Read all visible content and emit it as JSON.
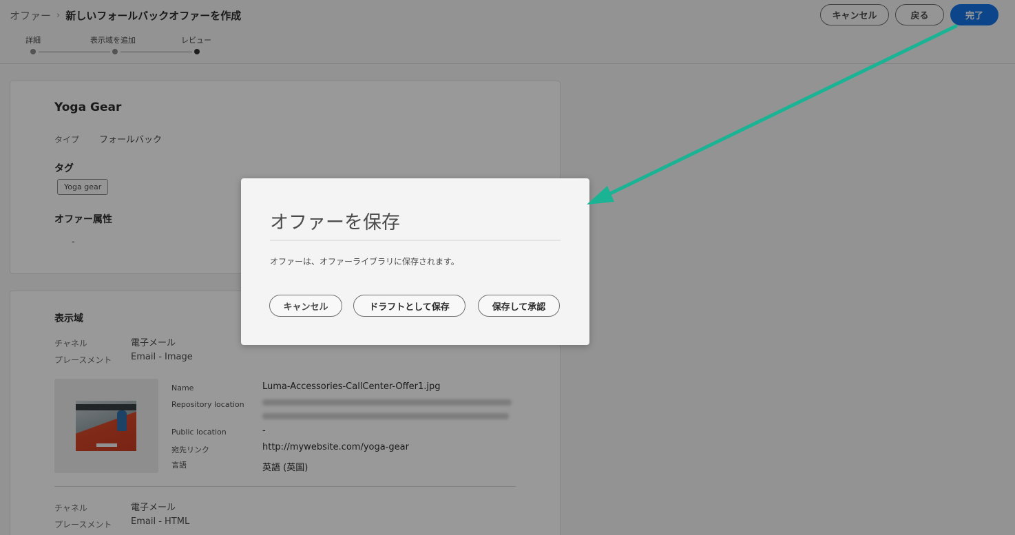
{
  "breadcrumb": {
    "root": "オファー",
    "separator": "›",
    "current": "新しいフォールバックオファーを作成"
  },
  "steps": [
    {
      "label": "詳細"
    },
    {
      "label": "表示域を追加"
    },
    {
      "label": "レビュー"
    }
  ],
  "header_buttons": {
    "cancel": "キャンセル",
    "back": "戻る",
    "done": "完了"
  },
  "offer": {
    "name": "Yoga Gear",
    "type_label": "タイプ",
    "type_value": "フォールバック",
    "tags_heading": "タグ",
    "tags": [
      "Yoga gear"
    ],
    "attributes_heading": "オファー属性",
    "attributes_value": "-"
  },
  "representations": {
    "heading": "表示域",
    "items": [
      {
        "channel_label": "チャネル",
        "channel_value": "電子メール",
        "placement_label": "プレースメント",
        "placement_value": "Email - Image",
        "details": {
          "name_label": "Name",
          "name_value": "Luma-Accessories-CallCenter-Offer1.jpg",
          "repo_label": "Repository location",
          "public_label": "Public location",
          "public_value": "-",
          "dest_label": "宛先リンク",
          "dest_value": "http://mywebsite.com/yoga-gear",
          "lang_label": "言語",
          "lang_value": "英語 (英国)"
        }
      },
      {
        "channel_label": "チャネル",
        "channel_value": "電子メール",
        "placement_label": "プレースメント",
        "placement_value": "Email - HTML"
      }
    ]
  },
  "dialog": {
    "title": "オファーを保存",
    "message": "オファーは、オファーライブラリに保存されます。",
    "buttons": {
      "cancel": "キャンセル",
      "save_draft": "ドラフトとして保存",
      "save_approve": "保存して承認"
    }
  },
  "colors": {
    "accent_blue": "#1473e6",
    "annotation_arrow": "#1ab394"
  },
  "icons": {
    "breadcrumb_separator": "chevron-right-icon"
  }
}
